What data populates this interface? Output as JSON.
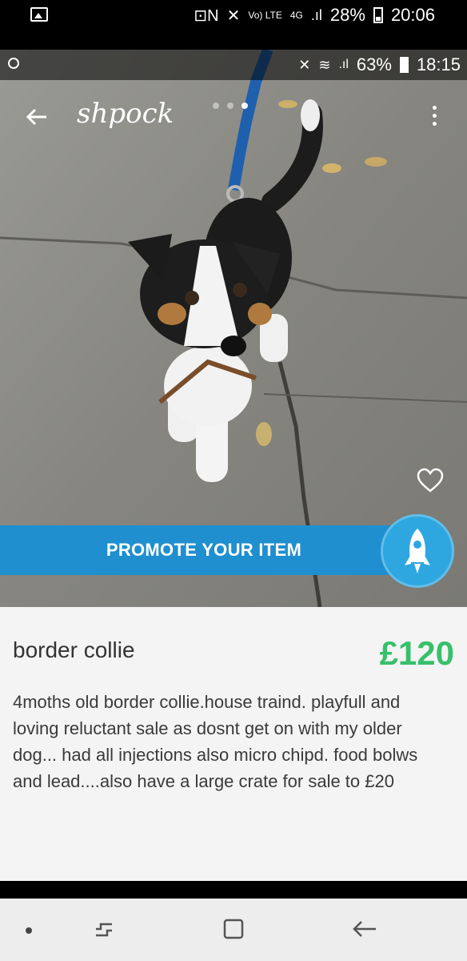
{
  "outer_status": {
    "network": "Vo) LTE",
    "network_gen": "4G",
    "battery": "28%",
    "time": "20:06"
  },
  "inner_status": {
    "battery": "63%",
    "time": "18:15"
  },
  "app": {
    "logo": "shpock"
  },
  "promote": {
    "label": "PROMOTE YOUR ITEM"
  },
  "listing": {
    "title": "border collie",
    "price": "£120",
    "description": "4moths old border collie.house traind. playfull and loving reluctant sale as dosnt get on with my older dog... had all injections also micro chipd. food bolws and lead....also have a large crate for sale to £20"
  },
  "icons": [
    "image-icon",
    "nfc-icon",
    "mute-icon",
    "signal-icon",
    "battery-icon",
    "back-arrow-icon",
    "more-icon",
    "heart-icon",
    "rocket-icon",
    "recent-apps-icon",
    "home-icon",
    "nav-back-icon"
  ]
}
